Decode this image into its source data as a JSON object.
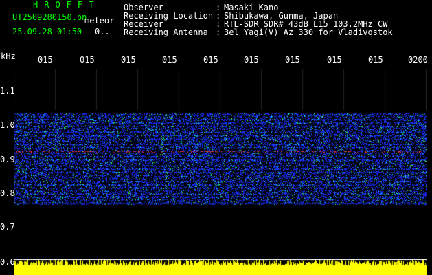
{
  "header": {
    "brand": "HROFFT",
    "filename": "UT2509280150.pn",
    "meteor_label": "meteor",
    "datetime": "25.09.28 01:50",
    "count": "0.."
  },
  "info": [
    {
      "label": "Observer",
      "sep": ":",
      "value": "Masaki Kano"
    },
    {
      "label": "Receiving Location",
      "sep": ":",
      "value": "Shibukawa, Gunma, Japan"
    },
    {
      "label": "Receiver",
      "sep": ":",
      "value": "RTL-SDR SDR# 43dB L15 103.2MHz CW"
    },
    {
      "label": "Receiving Antenna",
      "sep": ":",
      "value": "3el Yagi(V) Az 330 for Vladivostok"
    }
  ],
  "axis": {
    "unit": "kHz",
    "x_ticks": [
      "015",
      "015",
      "015",
      "015",
      "015",
      "015",
      "015",
      "015",
      "015",
      "0200"
    ],
    "y_ticks": [
      "1.1",
      "1.0",
      "0.9",
      "0.8",
      "0.7",
      "0.6"
    ]
  },
  "colors": {
    "background": "#000000",
    "header_green": "#00ff00",
    "text_white": "#ffffff",
    "signal_blue": "#1a2cff",
    "signal_cyan": "#00e0ff",
    "signal_green": "#36ff5a",
    "signal_red": "#ff3040",
    "level_yellow": "#ffff00"
  }
}
